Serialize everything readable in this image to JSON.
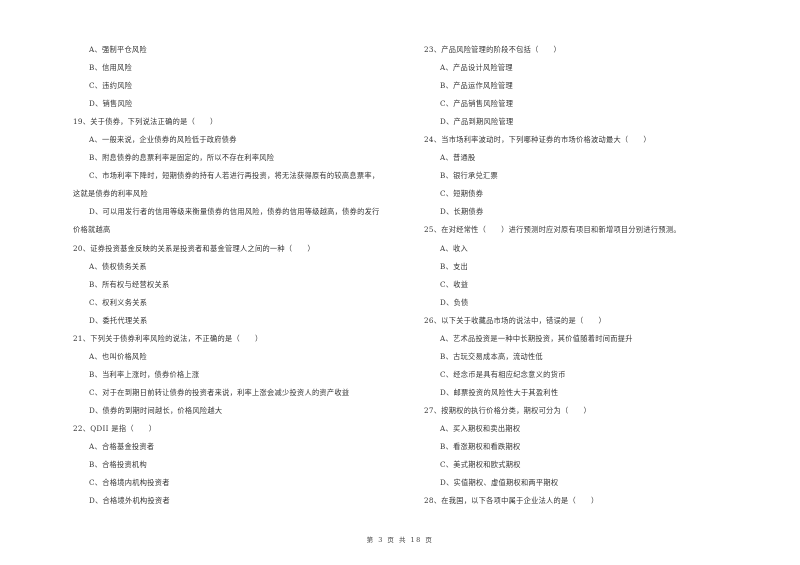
{
  "page": {
    "footer": "第 3 页 共 18 页"
  },
  "left_column": {
    "q18_tail": {
      "options": [
        "A、强制平仓风险",
        "B、信用风险",
        "C、违约风险",
        "D、销售风险"
      ]
    },
    "q19": {
      "stem": "19、关于债券，下列说法正确的是（　　）",
      "options": [
        "A、一般来说，企业债券的风险低于政府债券",
        "B、附息债券的息票利率是固定的，所以不存在利率风险",
        "C、市场利率下降时，短期债券的持有人若进行再投资，将无法获得原有的较高息票率，",
        "这就是债券的利率风险",
        "D、可以用发行者的信用等级来衡量债券的信用风险，债券的信用等级越高，债券的发行",
        "价格就越高"
      ]
    },
    "q20": {
      "stem": "20、证券投资基金反映的关系是投资者和基金管理人之间的一种（　　）",
      "options": [
        "A、债权债务关系",
        "B、所有权与经营权关系",
        "C、权利义务关系",
        "D、委托代理关系"
      ]
    },
    "q21": {
      "stem": "21、下列关于债券利率风险的说法，不正确的是（　　）",
      "options": [
        "A、也叫价格风险",
        "B、当利率上涨时，债券价格上涨",
        "C、对于在到期日前转让债券的投资者来说，利率上涨会减少投资人的资产收益",
        "D、债券的到期时间越长，价格风险越大"
      ]
    },
    "q22": {
      "stem": "22、QDII 是指（　　）",
      "options": [
        "A、合格基金投资者",
        "B、合格投资机构",
        "C、合格境内机构投资者",
        "D、合格境外机构投资者"
      ]
    }
  },
  "right_column": {
    "q23": {
      "stem": "23、产品风险管理的阶段不包括（　　）",
      "options": [
        "A、产品设计风险管理",
        "B、产品运作风险管理",
        "C、产品销售风险管理",
        "D、产品到期风险管理"
      ]
    },
    "q24": {
      "stem": "24、当市场利率波动时，下列哪种证券的市场价格波动最大（　　）",
      "options": [
        "A、普通股",
        "B、银行承兑汇票",
        "C、短期债券",
        "D、长期债券"
      ]
    },
    "q25": {
      "stem": "25、在对经常性（　　）进行预测时应对原有项目和新增项目分别进行预测。",
      "options": [
        "A、收入",
        "B、支出",
        "C、收益",
        "D、负债"
      ]
    },
    "q26": {
      "stem": "26、以下关于收藏品市场的说法中，错误的是（　　）",
      "options": [
        "A、艺术品投资是一种中长期投资，其价值随着时间而提升",
        "B、古玩交易成本高，流动性低",
        "C、经念币是具有相应纪念意义的货币",
        "D、邮票投资的风险性大于其盈利性"
      ]
    },
    "q27": {
      "stem": "27、按期权的执行价格分类，期权可分为（　　）",
      "options": [
        "A、买入期权和卖出期权",
        "B、看涨期权和看跌期权",
        "C、美式期权和欧式期权",
        "D、实值期权、虚值期权和两平期权"
      ]
    },
    "q28": {
      "stem": "28、在我国，以下各项中属于企业法人的是（　　）"
    }
  }
}
